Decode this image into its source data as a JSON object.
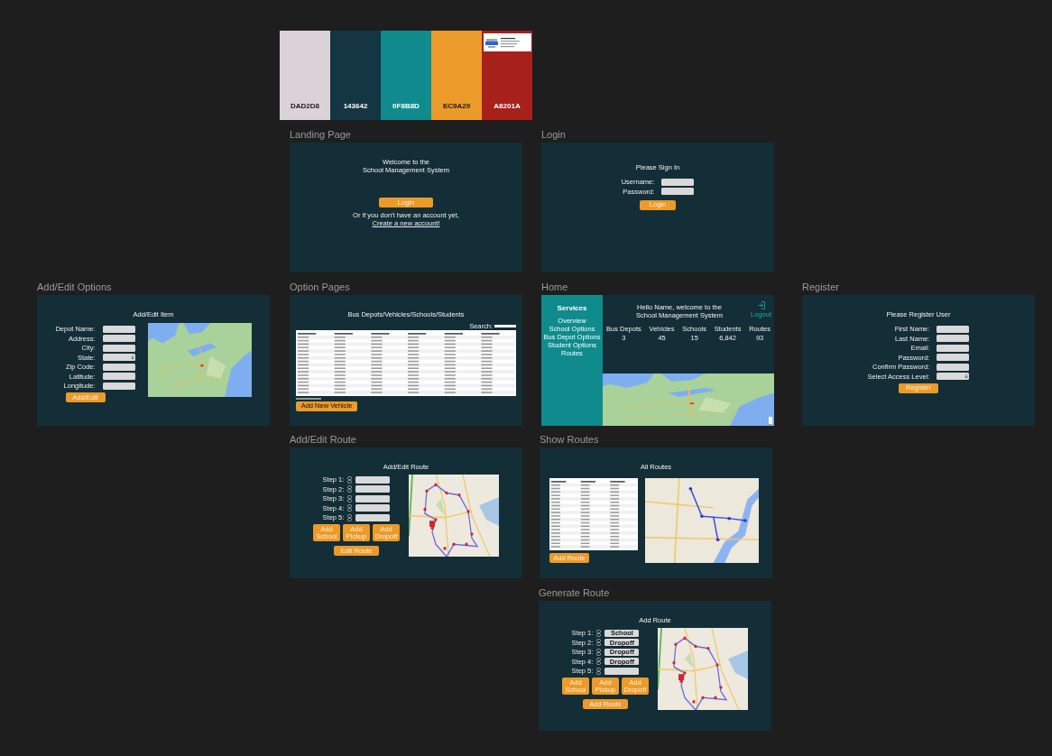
{
  "palette": {
    "swatches": [
      {
        "hex": "DAD2D8",
        "color": "#dad2d8"
      },
      {
        "hex": "143642",
        "color": "#143642"
      },
      {
        "hex": "0F8B8D",
        "color": "#0f8b8d"
      },
      {
        "hex": "EC9A29",
        "color": "#ec9a29"
      },
      {
        "hex": "A8201A",
        "color": "#a8201a"
      }
    ]
  },
  "frames": [
    {
      "kind": "landing",
      "label": "Landing Page",
      "title": [
        "Welcome to the",
        "School Management System"
      ],
      "button": "Login",
      "note": "Or if you don't have an account yet,",
      "link": "Create a new account!"
    },
    {
      "kind": "login",
      "label": "Login",
      "title": [
        "Please Sign In"
      ],
      "fields": [
        {
          "label": "Username:",
          "kind": "input"
        },
        {
          "label": "Password:",
          "kind": "input"
        }
      ],
      "button": "Login"
    },
    {
      "kind": "item_form",
      "label": "Add/Edit Options",
      "title": [
        "Add/Edit Item"
      ],
      "fields": [
        {
          "label": "Depot Name:",
          "kind": "input"
        },
        {
          "label": "Address:",
          "kind": "input"
        },
        {
          "label": "City:",
          "kind": "input"
        },
        {
          "label": "State:",
          "kind": "select"
        },
        {
          "label": "Zip Code:",
          "kind": "input"
        },
        {
          "label": "Latitude:",
          "kind": "input"
        },
        {
          "label": "Longitude:",
          "kind": "input"
        }
      ],
      "button": "Add/Edit"
    },
    {
      "kind": "list",
      "label": "Option Pages",
      "title": [
        "Bus Depots/Vehicles/Schools/Students"
      ],
      "search_label": "Search:",
      "button": "Add New Vehicle"
    },
    {
      "kind": "home",
      "label": "Home",
      "sidebar": {
        "title": "Services",
        "items": [
          "Overview",
          "School Options",
          "Bus Depot Options",
          "Student Options",
          "Routes"
        ]
      },
      "title": [
        "Hello Name, welcome to the",
        "School Management System"
      ],
      "logout": "Logout",
      "stats": [
        {
          "label": "Bus Depots",
          "value": "3"
        },
        {
          "label": "Vehicles",
          "value": "45"
        },
        {
          "label": "Schools",
          "value": "15"
        },
        {
          "label": "Students",
          "value": "6,842"
        },
        {
          "label": "Routes",
          "value": "93"
        }
      ]
    },
    {
      "kind": "register",
      "label": "Register",
      "title": [
        "Please Register User"
      ],
      "fields": [
        {
          "label": "First Name:",
          "kind": "input"
        },
        {
          "label": "Last Name:",
          "kind": "input"
        },
        {
          "label": "Email:",
          "kind": "input"
        },
        {
          "label": "Password:",
          "kind": "input"
        },
        {
          "label": "Confirm Password:",
          "kind": "input"
        },
        {
          "label": "Select Access Level:",
          "kind": "select"
        }
      ],
      "button": "Register"
    },
    {
      "kind": "route_form",
      "label": "Add/Edit Route",
      "title": [
        "Add/Edit Route"
      ],
      "steps": [
        {
          "label": "Step 1:"
        },
        {
          "label": "Step 2:"
        },
        {
          "label": "Step 3:"
        },
        {
          "label": "Step 4:"
        },
        {
          "label": "Step 5:"
        }
      ],
      "actions": [
        "Add School",
        "Add Pickup",
        "Add Dropoff"
      ],
      "button": "Edit Route"
    },
    {
      "kind": "routes",
      "label": "Show Routes",
      "title": [
        "All Routes"
      ],
      "button": "Add Route"
    },
    {
      "kind": "route_form",
      "label": "Generate Route",
      "title": [
        "Add Route"
      ],
      "steps": [
        {
          "label": "Step 1:",
          "value": "School"
        },
        {
          "label": "Step 2:",
          "value": "Dropoff"
        },
        {
          "label": "Step 3:",
          "value": "Dropoff"
        },
        {
          "label": "Step 4:",
          "value": "Dropoff"
        },
        {
          "label": "Step 5:"
        }
      ],
      "actions": [
        "Add School",
        "Add Pickup",
        "Add Dropoff"
      ],
      "button": "Add Route"
    }
  ]
}
